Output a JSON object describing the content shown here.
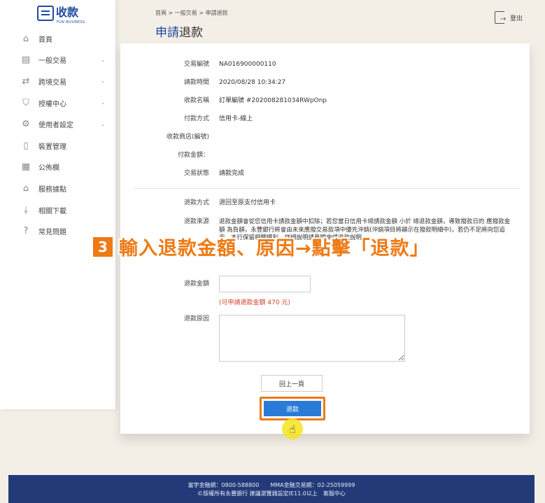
{
  "brand": {
    "name": "收款",
    "subtitle": "FUN BUSINESS"
  },
  "sidebar": {
    "items": [
      {
        "label": "首頁",
        "icon": "home-icon",
        "glyph": "⌂",
        "chevron": false
      },
      {
        "label": "一般交易",
        "icon": "receipt-icon",
        "glyph": "▤",
        "chevron": true
      },
      {
        "label": "跨境交易",
        "icon": "exchange-icon",
        "glyph": "⇄",
        "chevron": true
      },
      {
        "label": "授權中心",
        "icon": "shield-icon",
        "glyph": "⛉",
        "chevron": true
      },
      {
        "label": "使用者設定",
        "icon": "gear-icon",
        "glyph": "⚙",
        "chevron": true
      },
      {
        "label": "裝置管理",
        "icon": "device-icon",
        "glyph": "▯",
        "chevron": false
      },
      {
        "label": "公佈欄",
        "icon": "board-icon",
        "glyph": "▦",
        "chevron": false
      },
      {
        "label": "服務據點",
        "icon": "bank-icon",
        "glyph": "⌂",
        "chevron": false
      },
      {
        "label": "相關下載",
        "icon": "download-icon",
        "glyph": "⤓",
        "chevron": false
      },
      {
        "label": "常見問題",
        "icon": "question-icon",
        "glyph": "?",
        "chevron": false
      }
    ],
    "chevron_glyph": "⌄"
  },
  "header": {
    "breadcrumb": "首頁 > 一般交易 > 申請退款",
    "title_accent": "申請",
    "title_rest": "退款",
    "logout_label": "登出"
  },
  "details": {
    "rows": [
      {
        "label": "交易編號",
        "value": "NA016900000110"
      },
      {
        "label": "請款時間",
        "value": "2020/08/28 10:34:27"
      },
      {
        "label": "收款名稱",
        "value": "訂單編號 #202008281034RWpOnp"
      },
      {
        "label": "付款方式",
        "value": "信用卡-線上"
      },
      {
        "label": "收款商店(編號)",
        "value": ""
      },
      {
        "label": "付款金額：",
        "value": ""
      },
      {
        "label": "交易狀態",
        "value": "請款完成"
      }
    ]
  },
  "refund": {
    "method_label": "退款方式",
    "method_value": "退回至原支付信用卡",
    "source_label": "退款來源",
    "source_text": "退款金額會從您信用卡請款金額中扣除；若您當日信用卡總請款金額 小於 總退款金額，導致撥款日的 應撥款金額 為負額，永豐銀行將會由未來應撥交易款項中優先沖銷(沖銷項目將顯示在撥款明細中)，若仍不足將向您追索，本行保留相關權利，詳細說明請參閱申請退款說明。",
    "amount_label": "退款金額",
    "amount_value": "",
    "amount_hint": "(可申請退款金額 470 元)",
    "reason_label": "退款原因",
    "reason_value": "",
    "back_button": "回上一頁",
    "refund_button": "退款"
  },
  "annotation": {
    "step": "3",
    "text": "輸入退款金額、原因→點擊「退款」",
    "color": "#ee7a14"
  },
  "footer": {
    "line1": "富宇金融網：0800-588800　　MMA金融交易網：02-25059999",
    "line2": "©版權所有永豐銀行 建議瀏覽器設定IE11.0以上　客服中心"
  },
  "colors": {
    "brand": "#1f4aa0",
    "primary_button": "#2a7bd8",
    "footer_bg": "#233a78",
    "hint": "#d0402a"
  }
}
